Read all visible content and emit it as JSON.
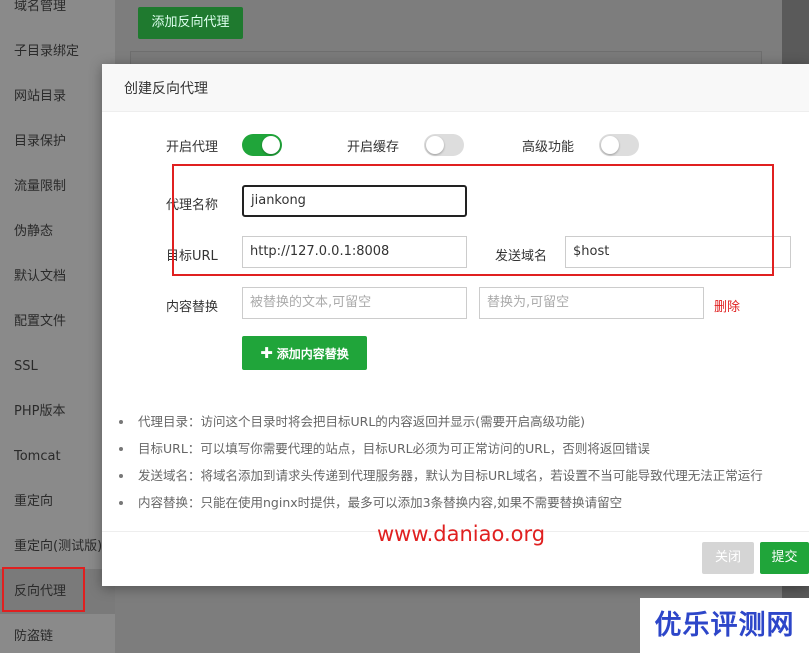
{
  "sidebar": {
    "items": [
      {
        "label": "域名管理"
      },
      {
        "label": "子目录绑定"
      },
      {
        "label": "网站目录"
      },
      {
        "label": "目录保护"
      },
      {
        "label": "流量限制"
      },
      {
        "label": "伪静态"
      },
      {
        "label": "默认文档"
      },
      {
        "label": "配置文件"
      },
      {
        "label": "SSL"
      },
      {
        "label": "PHP版本"
      },
      {
        "label": "Tomcat"
      },
      {
        "label": "重定向"
      },
      {
        "label": "重定向(测试版)"
      },
      {
        "label": "反向代理"
      },
      {
        "label": "防盗链"
      }
    ],
    "active_index": 13
  },
  "top_toolbar": {
    "add_proxy_label": "添加反向代理"
  },
  "modal": {
    "title": "创建反向代理",
    "toggles": {
      "enable_proxy": {
        "label": "开启代理",
        "on": true
      },
      "enable_cache": {
        "label": "开启缓存",
        "on": false
      },
      "advanced": {
        "label": "高级功能",
        "on": false
      }
    },
    "proxy_name": {
      "label": "代理名称",
      "value": "jiankong"
    },
    "target_url": {
      "label": "目标URL",
      "value": "http://127.0.0.1:8008"
    },
    "send_domain": {
      "label": "发送域名",
      "value": "$host"
    },
    "content_replace": {
      "label": "内容替换",
      "from_placeholder": "被替换的文本,可留空",
      "to_placeholder": "替换为,可留空",
      "delete_label": "删除",
      "add_label": "添加内容替换"
    },
    "notes": [
      "代理目录：访问这个目录时将会把目标URL的内容返回并显示(需要开启高级功能)",
      "目标URL：可以填写你需要代理的站点，目标URL必须为可正常访问的URL，否则将返回错误",
      "发送域名：将域名添加到请求头传递到代理服务器，默认为目标URL域名，若设置不当可能导致代理无法正常运行",
      "内容替换：只能在使用nginx时提供，最多可以添加3条替换内容,如果不需要替换请留空"
    ],
    "close_label": "关闭",
    "submit_label": "提交"
  },
  "watermarks": {
    "url": "www.daniao.org",
    "logo": "优乐评测网"
  },
  "colors": {
    "accent_green": "#20a53a",
    "highlight_red": "#e02020",
    "logo_blue": "#2d46c9"
  }
}
